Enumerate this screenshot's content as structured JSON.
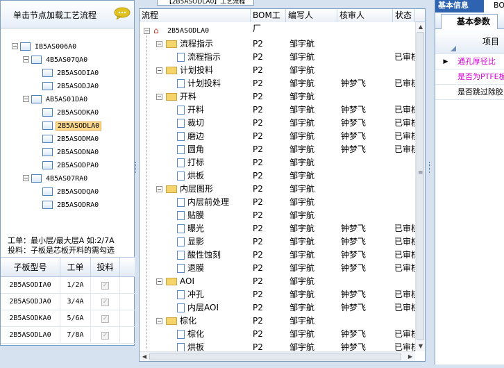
{
  "left_panel": {
    "header": "单击节点加载工艺流程",
    "tree": [
      {
        "label": "IB5AS006A0",
        "level": 0
      },
      {
        "label": "4B5AS07QA0",
        "level": 1
      },
      {
        "label": "2B5ASODIA0",
        "level": 2
      },
      {
        "label": "2B5ASODJA0",
        "level": 2
      },
      {
        "label": "AB5AS01DA0",
        "level": 1
      },
      {
        "label": "2B5ASODKA0",
        "level": 2
      },
      {
        "label": "2B5ASODLA0",
        "level": 2,
        "selected": true
      },
      {
        "label": "2B5ASODMA0",
        "level": 2
      },
      {
        "label": "2B5ASODNA0",
        "level": 2
      },
      {
        "label": "2B5ASODPA0",
        "level": 2
      },
      {
        "label": "4B5AS07RA0",
        "level": 1
      },
      {
        "label": "2B5ASODQA0",
        "level": 2
      },
      {
        "label": "2B5ASODRA0",
        "level": 2
      }
    ],
    "info_line1": "工单：最小层/最大层A 如:2/7A",
    "info_line2": "投料：子板是芯板开料的需勾选",
    "grid": {
      "headers": [
        "子板型号",
        "工单",
        "投料"
      ],
      "rows": [
        {
          "model": "2B5ASODIA0",
          "order": "1/2A",
          "feed": true
        },
        {
          "model": "2B5ASODJA0",
          "order": "3/4A",
          "feed": true
        },
        {
          "model": "2B5ASODKA0",
          "order": "5/6A",
          "feed": true
        },
        {
          "model": "2B5ASODLA0",
          "order": "7/8A",
          "feed": true
        }
      ]
    }
  },
  "middle_panel": {
    "title": "【2B5ASODLA0】工艺流程",
    "headers": [
      "流程",
      "BOM工厂",
      "编写人",
      "核审人",
      "状态"
    ],
    "root": "2B5ASODLA0",
    "rows": [
      {
        "type": "folder",
        "label": "流程指示",
        "factory": "P2",
        "writer": "邹宇航",
        "reviewer": "",
        "status": ""
      },
      {
        "type": "doc",
        "label": "流程指示",
        "factory": "P2",
        "writer": "邹宇航",
        "reviewer": "",
        "status": "已审核"
      },
      {
        "type": "folder",
        "label": "计划投料",
        "factory": "P2",
        "writer": "邹宇航",
        "reviewer": "",
        "status": ""
      },
      {
        "type": "doc",
        "label": "计划投料",
        "factory": "P2",
        "writer": "邹宇航",
        "reviewer": "钟梦飞",
        "status": "已审核"
      },
      {
        "type": "folder",
        "label": "开料",
        "factory": "P2",
        "writer": "邹宇航",
        "reviewer": "",
        "status": ""
      },
      {
        "type": "doc",
        "label": "开料",
        "factory": "P2",
        "writer": "邹宇航",
        "reviewer": "钟梦飞",
        "status": "已审核"
      },
      {
        "type": "doc",
        "label": "裁切",
        "factory": "P2",
        "writer": "邹宇航",
        "reviewer": "钟梦飞",
        "status": "已审核"
      },
      {
        "type": "doc",
        "label": "磨边",
        "factory": "P2",
        "writer": "邹宇航",
        "reviewer": "钟梦飞",
        "status": "已审核"
      },
      {
        "type": "doc",
        "label": "圆角",
        "factory": "P2",
        "writer": "邹宇航",
        "reviewer": "钟梦飞",
        "status": "已审核"
      },
      {
        "type": "doc",
        "label": "打标",
        "factory": "P2",
        "writer": "邹宇航",
        "reviewer": "",
        "status": ""
      },
      {
        "type": "doc",
        "label": "烘板",
        "factory": "P2",
        "writer": "邹宇航",
        "reviewer": "",
        "status": ""
      },
      {
        "type": "folder",
        "label": "内层图形",
        "factory": "P2",
        "writer": "邹宇航",
        "reviewer": "",
        "status": ""
      },
      {
        "type": "doc",
        "label": "内层前处理",
        "factory": "P2",
        "writer": "邹宇航",
        "reviewer": "",
        "status": ""
      },
      {
        "type": "doc",
        "label": "贴膜",
        "factory": "P2",
        "writer": "邹宇航",
        "reviewer": "",
        "status": ""
      },
      {
        "type": "doc",
        "label": "曝光",
        "factory": "P2",
        "writer": "邹宇航",
        "reviewer": "钟梦飞",
        "status": "已审核"
      },
      {
        "type": "doc",
        "label": "显影",
        "factory": "P2",
        "writer": "邹宇航",
        "reviewer": "钟梦飞",
        "status": "已审核"
      },
      {
        "type": "doc",
        "label": "酸性蚀刻",
        "factory": "P2",
        "writer": "邹宇航",
        "reviewer": "钟梦飞",
        "status": "已审核"
      },
      {
        "type": "doc",
        "label": "退膜",
        "factory": "P2",
        "writer": "邹宇航",
        "reviewer": "钟梦飞",
        "status": "已审核"
      },
      {
        "type": "folder",
        "label": "AOI",
        "factory": "P2",
        "writer": "邹宇航",
        "reviewer": "",
        "status": ""
      },
      {
        "type": "doc",
        "label": "冲孔",
        "factory": "P2",
        "writer": "邹宇航",
        "reviewer": "钟梦飞",
        "status": "已审核"
      },
      {
        "type": "doc",
        "label": "内层AOI",
        "factory": "P2",
        "writer": "邹宇航",
        "reviewer": "钟梦飞",
        "status": "已审核"
      },
      {
        "type": "folder",
        "label": "棕化",
        "factory": "P2",
        "writer": "邹宇航",
        "reviewer": "",
        "status": ""
      },
      {
        "type": "doc",
        "label": "棕化",
        "factory": "P2",
        "writer": "邹宇航",
        "reviewer": "钟梦飞",
        "status": "已审核"
      },
      {
        "type": "doc",
        "label": "烘板",
        "factory": "P2",
        "writer": "邹宇航",
        "reviewer": "钟梦飞",
        "status": "已审核"
      }
    ]
  },
  "right_panel": {
    "tab_active": "基本信息",
    "tab_other": "BOM",
    "subtab": "基本参数",
    "column_header": "项目",
    "rows": [
      {
        "text": "通孔厚径比",
        "color": "#d400d4"
      },
      {
        "text": "是否为PTFE板",
        "color": "#d400d4"
      },
      {
        "text": "是否跳过除胶",
        "color": "#000000"
      }
    ]
  },
  "colors": {
    "accent": "#2d63b0",
    "selected": "#fbd88b",
    "magenta": "#d400d4"
  }
}
